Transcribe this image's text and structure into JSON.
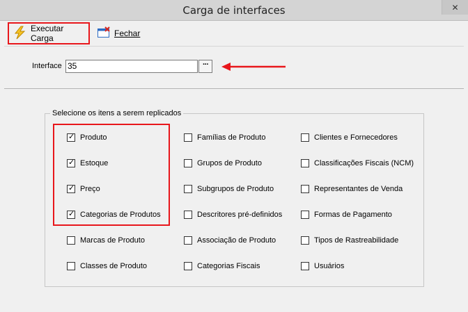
{
  "window": {
    "title": "Carga de interfaces",
    "close_glyph": "✕"
  },
  "toolbar": {
    "execute_label": "Executar Carga",
    "execute_icon": "lightning-icon",
    "close_label": "Fechar",
    "close_icon": "close-window-icon"
  },
  "interface": {
    "label": "Interface",
    "value": "35",
    "browse_label": "···"
  },
  "selection": {
    "title": "Selecione os itens a serem replicados",
    "items": [
      {
        "label": "Produto",
        "checked": true
      },
      {
        "label": "Estoque",
        "checked": true
      },
      {
        "label": "Preço",
        "checked": true
      },
      {
        "label": "Categorias de Produtos",
        "checked": true
      },
      {
        "label": "Marcas de Produto",
        "checked": false
      },
      {
        "label": "Classes de Produto",
        "checked": false
      },
      {
        "label": "Famílias de Produto",
        "checked": false
      },
      {
        "label": "Grupos de Produto",
        "checked": false
      },
      {
        "label": "Subgrupos de Produto",
        "checked": false
      },
      {
        "label": "Descritores pré-definidos",
        "checked": false
      },
      {
        "label": "Associação de Produto",
        "checked": false
      },
      {
        "label": "Categorias Fiscais",
        "checked": false
      },
      {
        "label": "Clientes e Fornecedores",
        "checked": false
      },
      {
        "label": "Classificações Fiscais (NCM)",
        "checked": false
      },
      {
        "label": "Representantes de Venda",
        "checked": false
      },
      {
        "label": "Formas de Pagamento",
        "checked": false
      },
      {
        "label": "Tipos de Rastreabilidade",
        "checked": false
      },
      {
        "label": "Usuários",
        "checked": false
      }
    ]
  },
  "colors": {
    "highlight": "#e8161b",
    "window_bg": "#f0f0f0",
    "titlebar": "#d4d4d4"
  }
}
